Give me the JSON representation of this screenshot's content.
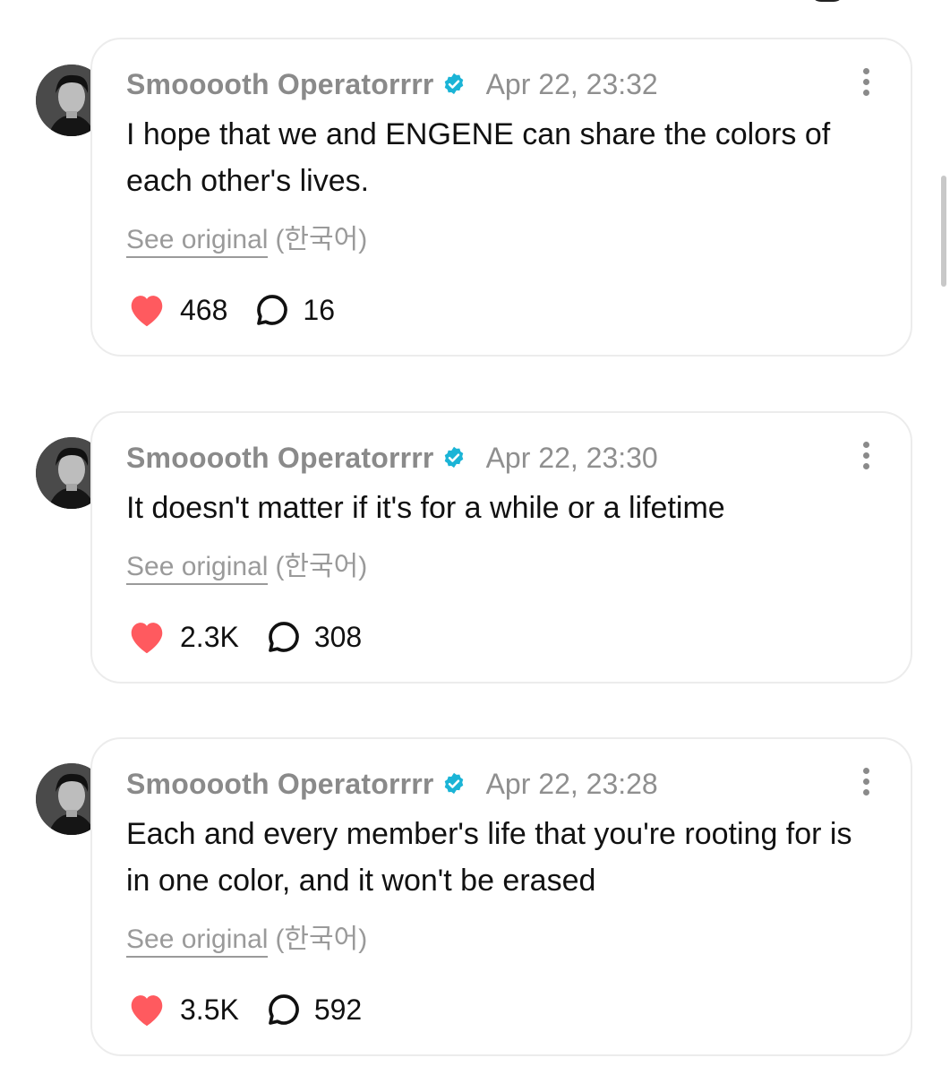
{
  "posts": [
    {
      "author": "Smooooth Operatorrrr",
      "timestamp": "Apr 22, 23:32",
      "text": "I hope that we and ENGENE can share the colors of each other's lives.",
      "see_original": "See original",
      "language": "(한국어)",
      "likes": "468",
      "replies": "16"
    },
    {
      "author": "Smooooth Operatorrrr",
      "timestamp": "Apr 22, 23:30",
      "text": "It doesn't matter if it's for a while or a lifetime",
      "see_original": "See original",
      "language": "(한국어)",
      "likes": "2.3K",
      "replies": "308"
    },
    {
      "author": "Smooooth Operatorrrr",
      "timestamp": "Apr 22, 23:28",
      "text": "Each and every member's life that you're rooting for is in one color, and it won't be erased",
      "see_original": "See original",
      "language": "(한국어)",
      "likes": "3.5K",
      "replies": "592"
    }
  ],
  "icons": {
    "verified": "verified-badge-icon",
    "more": "more-vertical-icon",
    "like": "heart-icon",
    "reply": "reply-bubble-icon"
  },
  "colors": {
    "verified": "#1bb4d6",
    "heart": "#ff5a5f",
    "muted_text": "#8a8a8a",
    "card_border": "#ececec"
  }
}
